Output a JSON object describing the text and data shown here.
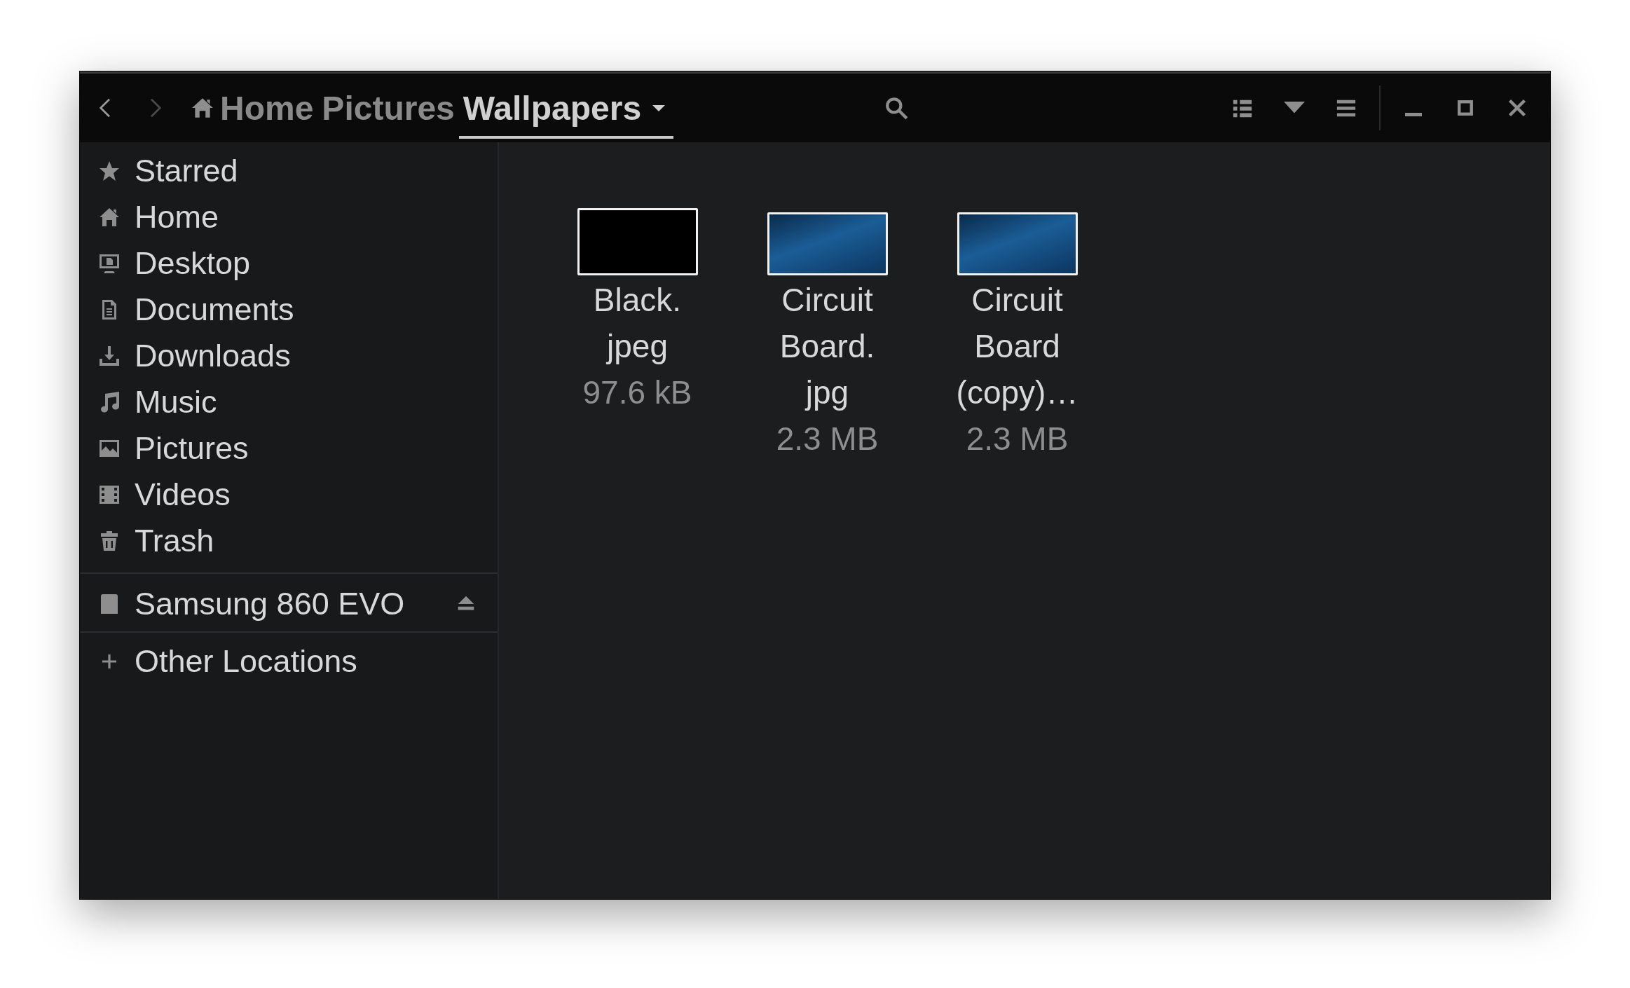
{
  "header": {
    "nav": [
      {
        "kind": "back",
        "disabled": false
      },
      {
        "kind": "forward",
        "disabled": true
      }
    ],
    "breadcrumbs": [
      {
        "label": "Home",
        "kind": "home",
        "selected": false
      },
      {
        "label": "Pictures",
        "kind": "folder",
        "selected": false
      },
      {
        "label": "Wallpapers",
        "kind": "folder",
        "selected": true
      }
    ]
  },
  "sidebar": {
    "places": [
      {
        "label": "Starred"
      },
      {
        "label": "Home"
      },
      {
        "label": "Desktop"
      },
      {
        "label": "Documents"
      },
      {
        "label": "Downloads"
      },
      {
        "label": "Music"
      },
      {
        "label": "Pictures"
      },
      {
        "label": "Videos"
      },
      {
        "label": "Trash"
      }
    ],
    "devices": [
      {
        "label": "Samsung 860 EVO",
        "ejectable": true
      }
    ],
    "other": [
      {
        "label": "Other Locations"
      }
    ]
  },
  "files": [
    {
      "name_lines": [
        "Black.",
        "jpeg"
      ],
      "size": "97.6 kB",
      "kind": "black"
    },
    {
      "name_lines": [
        "Circuit",
        "Board.",
        "jpg"
      ],
      "size": "2.3 MB",
      "kind": "photo"
    },
    {
      "name_lines": [
        "Circuit",
        "Board",
        "(copy)…"
      ],
      "size": "2.3 MB",
      "kind": "photo"
    }
  ]
}
